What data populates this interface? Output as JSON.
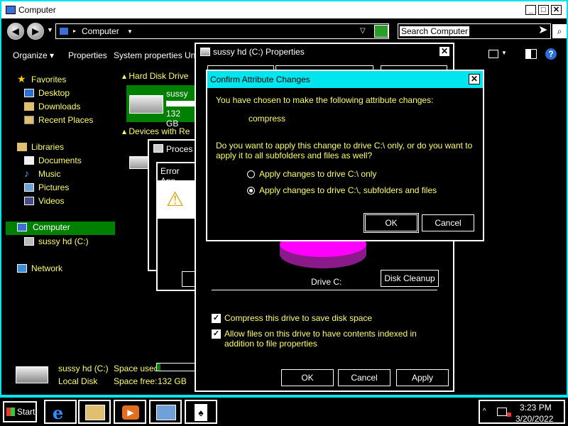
{
  "explorer": {
    "title": "Computer",
    "address_path": "Computer",
    "search_placeholder": "Search Computer",
    "commands": [
      "Organize",
      "Properties",
      "System properties",
      "Un"
    ],
    "nav": {
      "favorites": "Favorites",
      "desktop": "Desktop",
      "downloads": "Downloads",
      "recent": "Recent Places",
      "libraries": "Libraries",
      "documents": "Documents",
      "music": "Music",
      "pictures": "Pictures",
      "videos": "Videos",
      "computer": "Computer",
      "drive": "sussy hd (C:)",
      "network": "Network"
    },
    "sections": {
      "hard_disk": "Hard Disk Drive",
      "devices": "Devices with Re"
    },
    "drive_tile": {
      "name": "sussy h",
      "free": "132 GB"
    },
    "details": {
      "name": "sussy hd (C:)",
      "type": "Local Disk",
      "space_used_label": "Space used:",
      "space_free_label": "Space free:",
      "space_free_value": "132 GB",
      "used_fraction": 0.1
    }
  },
  "background_windows": {
    "process_title": "Proces",
    "error_title": "Error App"
  },
  "properties": {
    "title": "sussy hd (C:) Properties",
    "drive_label": "Drive C:",
    "disk_cleanup": "Disk Cleanup",
    "compress_label": "Compress this drive to save disk space",
    "index_label": "Allow files on this drive to have contents indexed in addition to file properties",
    "ok": "OK",
    "cancel": "Cancel",
    "apply": "Apply",
    "compress_checked": true,
    "index_checked": true
  },
  "confirm": {
    "title": "Confirm Attribute Changes",
    "intro": "You have chosen to make the following attribute changes:",
    "change": "compress",
    "question": "Do you want to apply this change to drive C:\\ only, or do you want to apply it to all subfolders and files as well?",
    "option1": "Apply changes to drive C:\\ only",
    "option2": "Apply changes to drive C:\\, subfolders and files",
    "selected": 2,
    "ok": "OK",
    "cancel": "Cancel"
  },
  "taskbar": {
    "start": "Start",
    "time": "3:23 PM",
    "date": "3/20/2022"
  },
  "colors": {
    "accent": "#00e5ee",
    "text_yellow": "#ffff66",
    "selection_green": "#008000",
    "pie_used": "#ff00ff"
  }
}
